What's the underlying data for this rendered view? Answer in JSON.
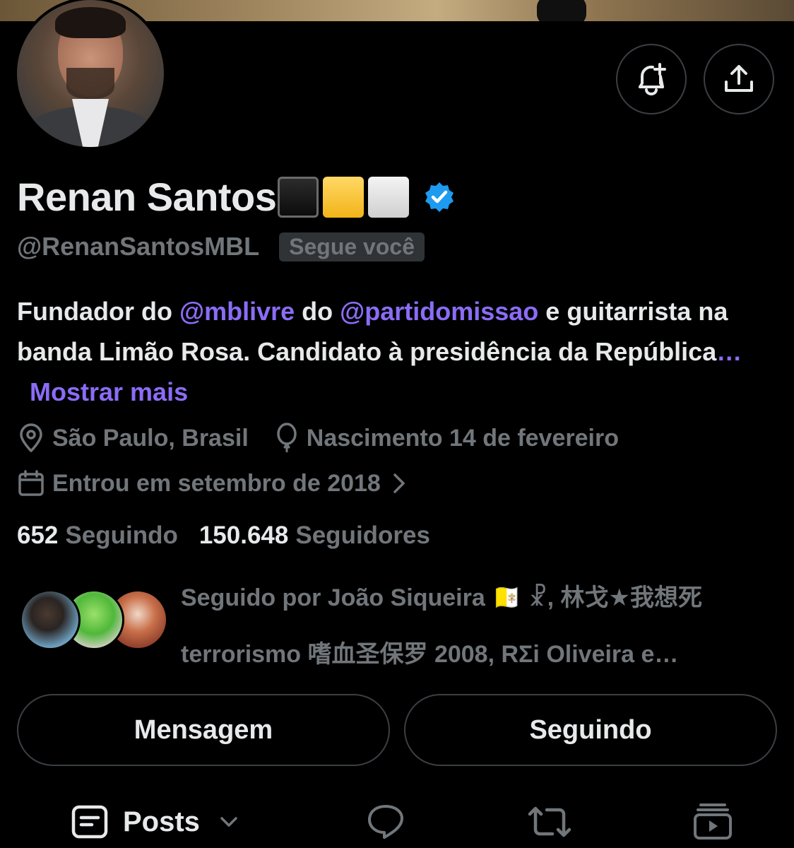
{
  "profile": {
    "name": "Renan Santos",
    "handle": "@RenanSantosMBL",
    "follows_you_badge": "Segue você",
    "bio": {
      "text1": "Fundador do ",
      "mention1": "@mblivre",
      "text2": " do ",
      "mention2": "@partidomissao",
      "text3": " e guitarrista na banda Limão Rosa. Candidato à presidência da República",
      "ellipsis": "…",
      "show_more": "Mostrar mais"
    },
    "location": "São Paulo, Brasil",
    "birth": "Nascimento 14 de fevereiro",
    "joined": "Entrou em setembro de 2018",
    "following_count": "652",
    "following_label": "Seguindo",
    "followers_count": "150.648",
    "followers_label": "Seguidores",
    "followed_by": "Seguido por João Siqueira 🇻🇦 ☧, 林戈★我想死 terrorismo 嗜血圣保罗 2008, RΣi Oliveira e…"
  },
  "buttons": {
    "message": "Mensagem",
    "following": "Seguindo"
  },
  "tabs": {
    "posts": "Posts"
  },
  "icons": {
    "notify": "bell-plus-icon",
    "share": "share-upload-icon",
    "verified": "verified-badge-icon",
    "location": "location-pin-icon",
    "birth": "balloon-icon",
    "joined": "calendar-icon"
  },
  "colors": {
    "background": "#000000",
    "text": "#e7e9ea",
    "muted": "#71767b",
    "mention": "#8b6cf6",
    "verified": "#1d9bf0",
    "border": "#3b3f44"
  }
}
